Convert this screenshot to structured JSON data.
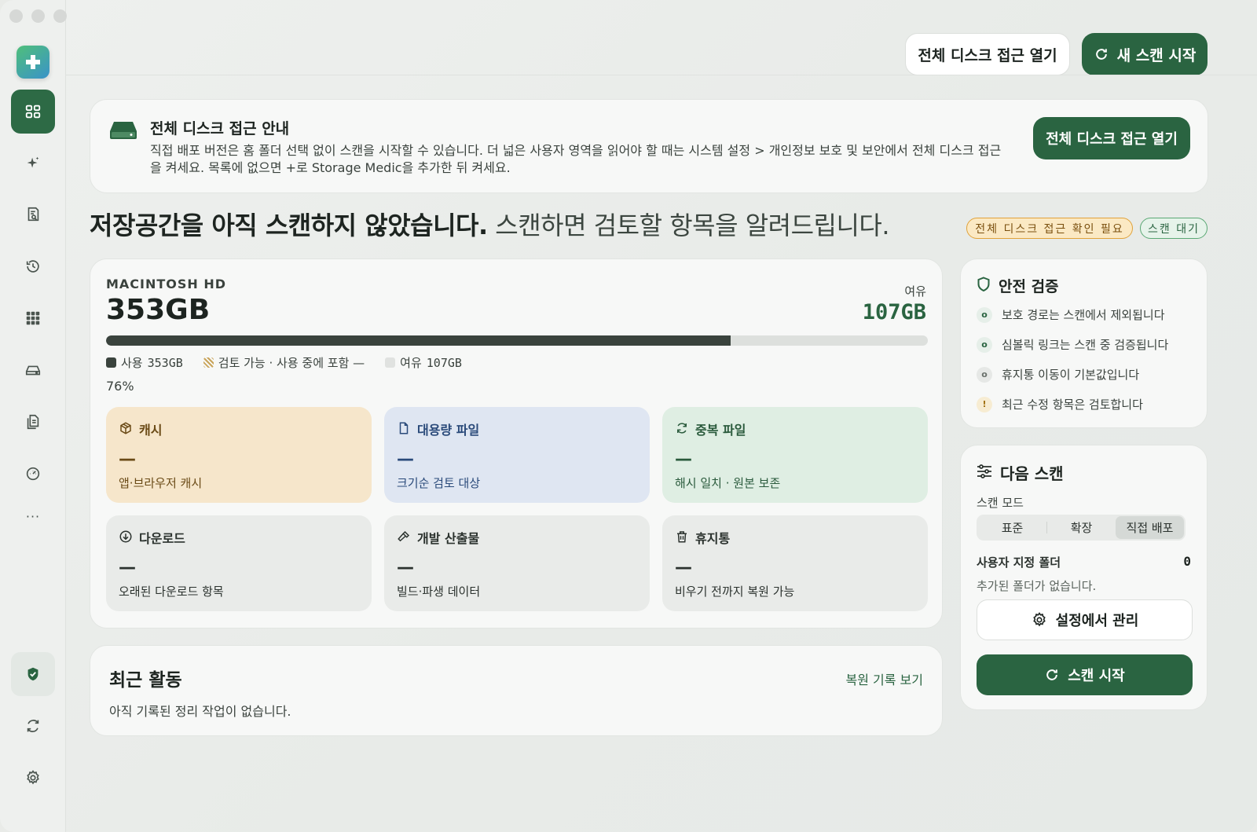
{
  "colors": {
    "accent": "#2a6441",
    "cache": "#f6e6cb",
    "large": "#dfe6f2",
    "dup": "#dfeee3"
  },
  "sidebar": {
    "items": [
      {
        "icon": "dashboard-icon"
      },
      {
        "icon": "sparkle-icon"
      },
      {
        "icon": "report-search-icon"
      },
      {
        "icon": "history-icon"
      },
      {
        "icon": "apps-grid-icon"
      },
      {
        "icon": "drive-icon"
      },
      {
        "icon": "documents-icon"
      },
      {
        "icon": "gauge-icon"
      },
      {
        "icon": "shield-check-icon"
      },
      {
        "icon": "refresh-icon"
      },
      {
        "icon": "gear-icon"
      }
    ],
    "more": "···"
  },
  "toolbar": {
    "open_full_disk": "전체 디스크 접근 열기",
    "new_scan": "새 스캔 시작"
  },
  "banner": {
    "title": "전체 디스크 접근 안내",
    "text": "직접 배포 버전은 홈 폴더 선택 없이 스캔을 시작할 수 있습니다. 더 넓은 사용자 영역을 읽어야 할 때는 시스템 설정 > 개인정보 보호 및 보안에서 전체 디스크 접근을 켜세요. 목록에 없으면 +로 Storage Medic을 추가한 뒤 켜세요.",
    "button": "전체 디스크 접근 열기"
  },
  "headline": {
    "main": "저장공간을 아직 스캔하지 않았습니다.",
    "sub": " 스캔하면 검토할 항목을 알려드립니다."
  },
  "badges": {
    "warn": "전체 디스크 접근 확인 필요",
    "status": "스캔 대기"
  },
  "disk": {
    "name": "MACINTOSH HD",
    "total": "353GB",
    "free_label": "여유",
    "free_value": "107GB",
    "used_fraction": 0.76,
    "legend_used_label": "사용",
    "legend_used_value": "353GB",
    "legend_review": "검토 가능 · 사용 중에 포함 —",
    "legend_free_label": "여유",
    "legend_free_value": "107GB",
    "percent": "76%"
  },
  "tiles": [
    {
      "title": "캐시",
      "value": "—",
      "desc": "앱·브라우저 캐시",
      "icon": "package-icon"
    },
    {
      "title": "대용량 파일",
      "value": "—",
      "desc": "크기순 검토 대상",
      "icon": "file-icon"
    },
    {
      "title": "중복 파일",
      "value": "—",
      "desc": "해시 일치 · 원본 보존",
      "icon": "sync-icon"
    },
    {
      "title": "다운로드",
      "value": "—",
      "desc": "오래된 다운로드 항목",
      "icon": "download-icon"
    },
    {
      "title": "개발 산출물",
      "value": "—",
      "desc": "빌드·파생 데이터",
      "icon": "hammer-icon"
    },
    {
      "title": "휴지통",
      "value": "—",
      "desc": "비우기 전까지 복원 가능",
      "icon": "trash-icon"
    }
  ],
  "activity": {
    "title": "최근 활동",
    "link": "복원 기록 보기",
    "empty": "아직 기록된 정리 작업이 없습니다."
  },
  "safety": {
    "title": "안전 검증",
    "items": [
      {
        "text": "보호 경로는 스캔에서 제외됩니다",
        "mark": "o"
      },
      {
        "text": "심볼릭 링크는 스캔 중 검증됩니다",
        "mark": "o"
      },
      {
        "text": "휴지통 이동이 기본값입니다",
        "mark": "o"
      },
      {
        "text": "최근 수정 항목은 검토합니다",
        "mark": "!"
      }
    ]
  },
  "next_scan": {
    "title": "다음 스캔",
    "mode_label": "스캔 모드",
    "modes": [
      "표준",
      "확장",
      "직접 배포"
    ],
    "selected_mode": "직접 배포",
    "folder_label": "사용자 지정 폴더",
    "folder_count": "0",
    "folder_empty": "추가된 폴더가 없습니다.",
    "manage": "설정에서 관리",
    "start": "스캔 시작"
  }
}
